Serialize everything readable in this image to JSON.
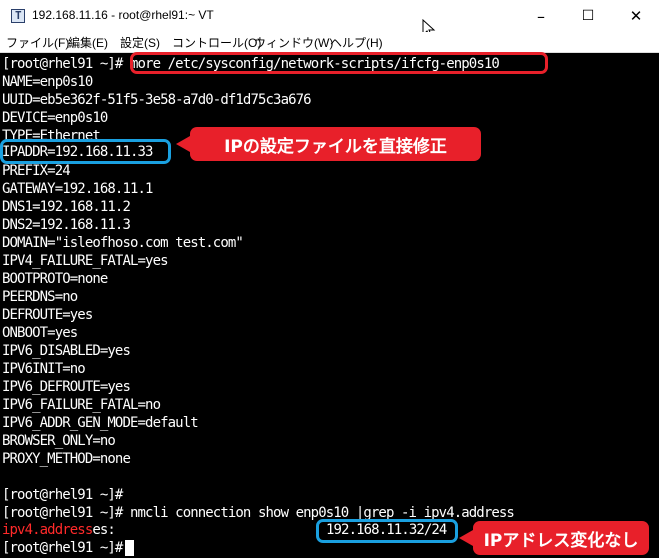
{
  "window": {
    "title": "192.168.11.16 - root@rhel91:~ VT",
    "icon": "terminal-app-icon",
    "minimize": "–",
    "maximize": "☐",
    "close": "✕"
  },
  "menu": [
    "ファイル(F)",
    "編集(E)",
    "設定(S)",
    "コントロール(O)",
    "ウィンドウ(W)",
    "ヘルプ(H)"
  ],
  "terminal": {
    "lines": [
      {
        "prompt": "[root@rhel91 ~]# ",
        "text": "more /etc/sysconfig/network-scripts/ifcfg-enp0s10"
      },
      {
        "text": "NAME=enp0s10"
      },
      {
        "text": "UUID=eb5e362f-51f5-3e58-a7d0-df1d75c3a676"
      },
      {
        "text": "DEVICE=enp0s10"
      },
      {
        "text": "TYPE=Ethernet"
      },
      {
        "text": "IPADDR=192.168.11.33"
      },
      {
        "text": "PREFIX=24"
      },
      {
        "text": "GATEWAY=192.168.11.1"
      },
      {
        "text": "DNS1=192.168.11.2"
      },
      {
        "text": "DNS2=192.168.11.3"
      },
      {
        "text": "DOMAIN=\"isleofhoso.com test.com\""
      },
      {
        "text": "IPV4_FAILURE_FATAL=yes"
      },
      {
        "text": "BOOTPROTO=none"
      },
      {
        "text": "PEERDNS=no"
      },
      {
        "text": "DEFROUTE=yes"
      },
      {
        "text": "ONBOOT=yes"
      },
      {
        "text": "IPV6_DISABLED=yes"
      },
      {
        "text": "IPV6INIT=no"
      },
      {
        "text": "IPV6_DEFROUTE=yes"
      },
      {
        "text": "IPV6_FAILURE_FATAL=no"
      },
      {
        "text": "IPV6_ADDR_GEN_MODE=default"
      },
      {
        "text": "BROWSER_ONLY=no"
      },
      {
        "text": "PROXY_METHOD=none"
      },
      {
        "text": ""
      },
      {
        "text": "[root@rhel91 ~]#"
      },
      {
        "text": "[root@rhel91 ~]# nmcli connection show enp0s10 |grep -i ipv4.address"
      },
      {
        "highlight": "ipv4.address",
        "rest": "es:",
        "value": "192.168.11.32/24"
      },
      {
        "text": "[root@rhel91 ~]#"
      }
    ]
  },
  "annotations": {
    "callout1": "IPの設定ファイルを直接修正",
    "callout2": "IPアドレス変化なし"
  },
  "colors": {
    "annotation_red": "#e8202a",
    "annotation_blue": "#1aa0e0"
  }
}
